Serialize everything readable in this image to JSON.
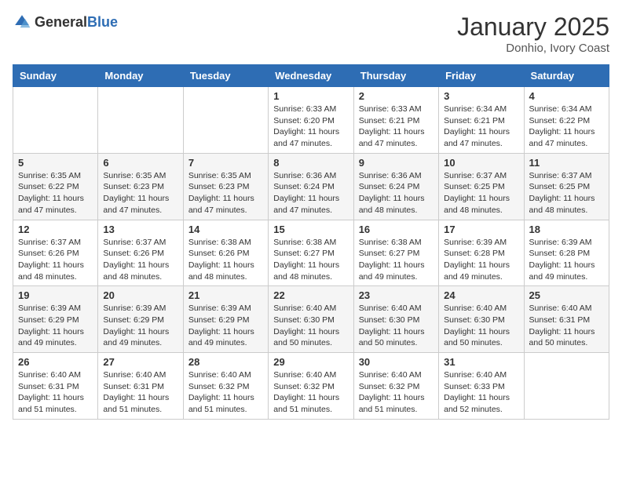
{
  "header": {
    "logo_general": "General",
    "logo_blue": "Blue",
    "month": "January 2025",
    "location": "Donhio, Ivory Coast"
  },
  "weekdays": [
    "Sunday",
    "Monday",
    "Tuesday",
    "Wednesday",
    "Thursday",
    "Friday",
    "Saturday"
  ],
  "weeks": [
    [
      {
        "day": "",
        "info": ""
      },
      {
        "day": "",
        "info": ""
      },
      {
        "day": "",
        "info": ""
      },
      {
        "day": "1",
        "info": "Sunrise: 6:33 AM\nSunset: 6:20 PM\nDaylight: 11 hours and 47 minutes."
      },
      {
        "day": "2",
        "info": "Sunrise: 6:33 AM\nSunset: 6:21 PM\nDaylight: 11 hours and 47 minutes."
      },
      {
        "day": "3",
        "info": "Sunrise: 6:34 AM\nSunset: 6:21 PM\nDaylight: 11 hours and 47 minutes."
      },
      {
        "day": "4",
        "info": "Sunrise: 6:34 AM\nSunset: 6:22 PM\nDaylight: 11 hours and 47 minutes."
      }
    ],
    [
      {
        "day": "5",
        "info": "Sunrise: 6:35 AM\nSunset: 6:22 PM\nDaylight: 11 hours and 47 minutes."
      },
      {
        "day": "6",
        "info": "Sunrise: 6:35 AM\nSunset: 6:23 PM\nDaylight: 11 hours and 47 minutes."
      },
      {
        "day": "7",
        "info": "Sunrise: 6:35 AM\nSunset: 6:23 PM\nDaylight: 11 hours and 47 minutes."
      },
      {
        "day": "8",
        "info": "Sunrise: 6:36 AM\nSunset: 6:24 PM\nDaylight: 11 hours and 47 minutes."
      },
      {
        "day": "9",
        "info": "Sunrise: 6:36 AM\nSunset: 6:24 PM\nDaylight: 11 hours and 48 minutes."
      },
      {
        "day": "10",
        "info": "Sunrise: 6:37 AM\nSunset: 6:25 PM\nDaylight: 11 hours and 48 minutes."
      },
      {
        "day": "11",
        "info": "Sunrise: 6:37 AM\nSunset: 6:25 PM\nDaylight: 11 hours and 48 minutes."
      }
    ],
    [
      {
        "day": "12",
        "info": "Sunrise: 6:37 AM\nSunset: 6:26 PM\nDaylight: 11 hours and 48 minutes."
      },
      {
        "day": "13",
        "info": "Sunrise: 6:37 AM\nSunset: 6:26 PM\nDaylight: 11 hours and 48 minutes."
      },
      {
        "day": "14",
        "info": "Sunrise: 6:38 AM\nSunset: 6:26 PM\nDaylight: 11 hours and 48 minutes."
      },
      {
        "day": "15",
        "info": "Sunrise: 6:38 AM\nSunset: 6:27 PM\nDaylight: 11 hours and 48 minutes."
      },
      {
        "day": "16",
        "info": "Sunrise: 6:38 AM\nSunset: 6:27 PM\nDaylight: 11 hours and 49 minutes."
      },
      {
        "day": "17",
        "info": "Sunrise: 6:39 AM\nSunset: 6:28 PM\nDaylight: 11 hours and 49 minutes."
      },
      {
        "day": "18",
        "info": "Sunrise: 6:39 AM\nSunset: 6:28 PM\nDaylight: 11 hours and 49 minutes."
      }
    ],
    [
      {
        "day": "19",
        "info": "Sunrise: 6:39 AM\nSunset: 6:29 PM\nDaylight: 11 hours and 49 minutes."
      },
      {
        "day": "20",
        "info": "Sunrise: 6:39 AM\nSunset: 6:29 PM\nDaylight: 11 hours and 49 minutes."
      },
      {
        "day": "21",
        "info": "Sunrise: 6:39 AM\nSunset: 6:29 PM\nDaylight: 11 hours and 49 minutes."
      },
      {
        "day": "22",
        "info": "Sunrise: 6:40 AM\nSunset: 6:30 PM\nDaylight: 11 hours and 50 minutes."
      },
      {
        "day": "23",
        "info": "Sunrise: 6:40 AM\nSunset: 6:30 PM\nDaylight: 11 hours and 50 minutes."
      },
      {
        "day": "24",
        "info": "Sunrise: 6:40 AM\nSunset: 6:30 PM\nDaylight: 11 hours and 50 minutes."
      },
      {
        "day": "25",
        "info": "Sunrise: 6:40 AM\nSunset: 6:31 PM\nDaylight: 11 hours and 50 minutes."
      }
    ],
    [
      {
        "day": "26",
        "info": "Sunrise: 6:40 AM\nSunset: 6:31 PM\nDaylight: 11 hours and 51 minutes."
      },
      {
        "day": "27",
        "info": "Sunrise: 6:40 AM\nSunset: 6:31 PM\nDaylight: 11 hours and 51 minutes."
      },
      {
        "day": "28",
        "info": "Sunrise: 6:40 AM\nSunset: 6:32 PM\nDaylight: 11 hours and 51 minutes."
      },
      {
        "day": "29",
        "info": "Sunrise: 6:40 AM\nSunset: 6:32 PM\nDaylight: 11 hours and 51 minutes."
      },
      {
        "day": "30",
        "info": "Sunrise: 6:40 AM\nSunset: 6:32 PM\nDaylight: 11 hours and 51 minutes."
      },
      {
        "day": "31",
        "info": "Sunrise: 6:40 AM\nSunset: 6:33 PM\nDaylight: 11 hours and 52 minutes."
      },
      {
        "day": "",
        "info": ""
      }
    ]
  ]
}
